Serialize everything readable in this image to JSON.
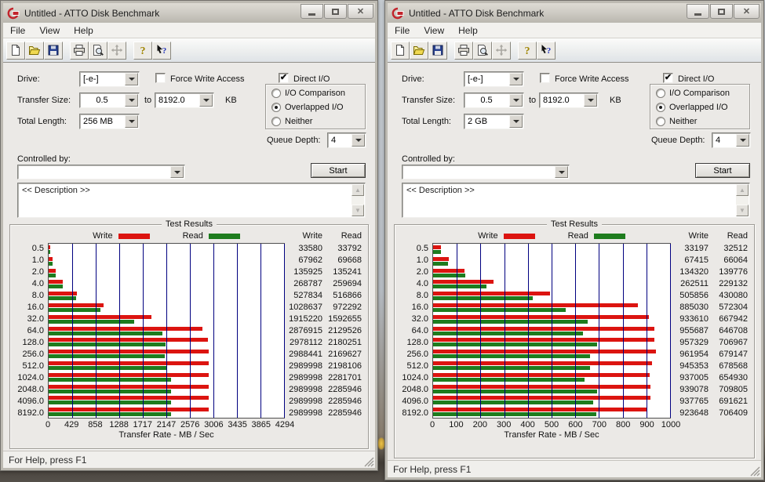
{
  "colors": {
    "write": "#dc1410",
    "read": "#1e7c1e",
    "grid": "#000080",
    "titlebar": "#cfccc5",
    "client_bg": "#ebe9e6"
  },
  "windows": [
    {
      "title": "Untitled - ATTO Disk Benchmark",
      "menu": {
        "items": [
          "File",
          "View",
          "Help"
        ]
      },
      "toolbar": {
        "buttons": [
          "new",
          "open",
          "save",
          "print",
          "print-preview",
          "move",
          "help",
          "context-help"
        ]
      },
      "controls": {
        "drive_label": "Drive:",
        "drive_value": "[-e-]",
        "force_write_label": "Force Write Access",
        "force_write_checked": false,
        "direct_io_label": "Direct I/O",
        "direct_io_checked": true,
        "transfer_size_label": "Transfer Size:",
        "transfer_from": "0.5",
        "to_label": "to",
        "transfer_to": "8192.0",
        "unit_label": "KB",
        "io_options": [
          "I/O Comparison",
          "Overlapped I/O",
          "Neither"
        ],
        "io_selected": "Overlapped I/O",
        "io_radio_checked": [
          false,
          true,
          false
        ],
        "total_length_label": "Total Length:",
        "total_length_value": "256 MB",
        "queue_depth_label": "Queue Depth:",
        "queue_depth_value": "4",
        "controlled_by_label": "Controlled by:",
        "controlled_by_value": "",
        "start_button": "Start",
        "description_text": "<< Description >>"
      },
      "results": {
        "group_title": "Test Results",
        "legend_write": "Write",
        "legend_read": "Read",
        "col_write_header": "Write",
        "col_read_header": "Read",
        "x_axis_label": "Transfer Rate - MB / Sec"
      },
      "chart_data": {
        "type": "bar",
        "orientation": "horizontal",
        "categories": [
          "0.5",
          "1.0",
          "2.0",
          "4.0",
          "8.0",
          "16.0",
          "32.0",
          "64.0",
          "128.0",
          "256.0",
          "512.0",
          "1024.0",
          "2048.0",
          "4096.0",
          "8192.0"
        ],
        "series": [
          {
            "name": "Write",
            "values": [
              33580,
              67962,
              135925,
              268787,
              527834,
              1028637,
              1915220,
              2876915,
              2978112,
              2988441,
              2989998,
              2989998,
              2989998,
              2989998,
              2989998
            ]
          },
          {
            "name": "Read",
            "values": [
              33792,
              69668,
              135241,
              259694,
              516866,
              972292,
              1592655,
              2129526,
              2180251,
              2169627,
              2198106,
              2281701,
              2285946,
              2285946,
              2285946
            ]
          }
        ],
        "x_ticks": [
          0,
          429,
          858,
          1288,
          1717,
          2147,
          2576,
          3006,
          3435,
          3865,
          4294
        ],
        "xlabel": "Transfer Rate - MB / Sec",
        "legend_position": "top"
      },
      "status_bar": "For Help, press F1"
    },
    {
      "title": "Untitled - ATTO Disk Benchmark",
      "menu": {
        "items": [
          "File",
          "View",
          "Help"
        ]
      },
      "toolbar": {
        "buttons": [
          "new",
          "open",
          "save",
          "print",
          "print-preview",
          "move",
          "help",
          "context-help"
        ]
      },
      "controls": {
        "drive_label": "Drive:",
        "drive_value": "[-e-]",
        "force_write_label": "Force Write Access",
        "force_write_checked": false,
        "direct_io_label": "Direct I/O",
        "direct_io_checked": true,
        "transfer_size_label": "Transfer Size:",
        "transfer_from": "0.5",
        "to_label": "to",
        "transfer_to": "8192.0",
        "unit_label": "KB",
        "io_options": [
          "I/O Comparison",
          "Overlapped I/O",
          "Neither"
        ],
        "io_selected": "Overlapped I/O",
        "io_radio_checked": [
          false,
          true,
          false
        ],
        "total_length_label": "Total Length:",
        "total_length_value": "2 GB",
        "queue_depth_label": "Queue Depth:",
        "queue_depth_value": "4",
        "controlled_by_label": "Controlled by:",
        "controlled_by_value": "",
        "start_button": "Start",
        "description_text": "<< Description >>"
      },
      "results": {
        "group_title": "Test Results",
        "legend_write": "Write",
        "legend_read": "Read",
        "col_write_header": "Write",
        "col_read_header": "Read",
        "x_axis_label": "Transfer Rate - MB / Sec"
      },
      "chart_data": {
        "type": "bar",
        "orientation": "horizontal",
        "categories": [
          "0.5",
          "1.0",
          "2.0",
          "4.0",
          "8.0",
          "16.0",
          "32.0",
          "64.0",
          "128.0",
          "256.0",
          "512.0",
          "1024.0",
          "2048.0",
          "4096.0",
          "8192.0"
        ],
        "series": [
          {
            "name": "Write",
            "values": [
              33197,
              67415,
              134320,
              262511,
              505856,
              885030,
              933610,
              955687,
              957329,
              961954,
              945353,
              937005,
              939078,
              937765,
              923648
            ]
          },
          {
            "name": "Read",
            "values": [
              32512,
              66064,
              139776,
              229132,
              430080,
              572304,
              667942,
              646708,
              706967,
              679147,
              678568,
              654930,
              709805,
              691621,
              706409
            ]
          }
        ],
        "x_ticks": [
          0,
          100,
          200,
          300,
          400,
          500,
          600,
          700,
          800,
          900,
          1000
        ],
        "xlabel": "Transfer Rate - MB / Sec",
        "legend_position": "top"
      },
      "status_bar": "For Help, press F1"
    }
  ]
}
